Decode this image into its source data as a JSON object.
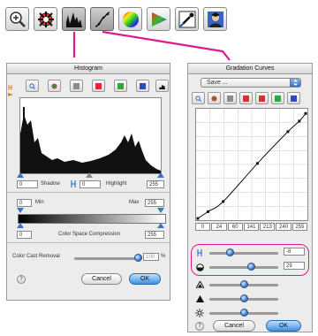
{
  "toolbar": {
    "buttons": [
      {
        "icon": "zoom-icon"
      },
      {
        "icon": "color-picker-icon"
      },
      {
        "icon": "histogram-icon",
        "active": true
      },
      {
        "icon": "gradation-curve-icon",
        "active": true
      },
      {
        "icon": "color-wheel-icon"
      },
      {
        "icon": "color-triangle-icon"
      },
      {
        "icon": "eyedropper-icon"
      },
      {
        "icon": "portrait-icon"
      }
    ]
  },
  "histogram": {
    "title": "Histogram",
    "shadow_value": "0",
    "shadow_label": "Shadow",
    "highlight_label": "Highlight",
    "mid_value": "0",
    "highlight_value": "255",
    "min_value": "0",
    "min_label": "Min",
    "max_label": "Max",
    "max_value": "255",
    "csc_min_value": "0",
    "csc_label": "Color Space Compression",
    "csc_max_value": "255",
    "cast_label": "Color Cast Removal",
    "cast_value": "100",
    "cast_unit": "%",
    "cast_level": 1.0,
    "cancel": "Cancel",
    "ok": "OK"
  },
  "gradation": {
    "title": "Gradation Curves",
    "preset": "Save ...",
    "ticks": [
      "0",
      "24",
      "60",
      "141",
      "213",
      "240",
      "255"
    ],
    "curve_points": [
      [
        0,
        0
      ],
      [
        24,
        16
      ],
      [
        60,
        40
      ],
      [
        141,
        130
      ],
      [
        213,
        205
      ],
      [
        240,
        230
      ],
      [
        255,
        248
      ]
    ],
    "highlight_value": "-8",
    "shadow_value": "29",
    "slider_levels": [
      0.3,
      0.6,
      0.5,
      0.5,
      0.5
    ],
    "cancel": "Cancel",
    "ok": "OK"
  },
  "colors": {
    "connector": "#e0188c",
    "swatch_gray": "#8c8c8c",
    "swatch_red": "#d8302c",
    "swatch_green": "#2fa83a",
    "swatch_blue": "#2a4fb0"
  }
}
